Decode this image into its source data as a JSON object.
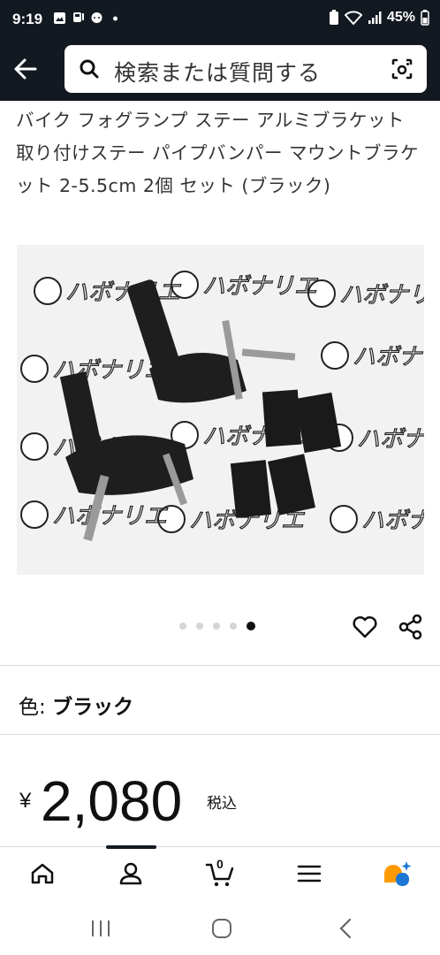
{
  "status_bar": {
    "time": "9:19",
    "battery": "45%"
  },
  "search": {
    "placeholder": "検索または質問する"
  },
  "product": {
    "title": "バイク フォグランプ ステー アルミブラケット 取り付けステー パイプバンパー マウントブラケット 2-5.5cm 2個 セット (ブラック)",
    "image_watermark": "ハボナリエ",
    "carousel": {
      "count": 5,
      "active_index": 4
    },
    "color_label": "色: ",
    "color_value": "ブラック",
    "currency": "¥",
    "price": "2,080",
    "tax_note": "税込"
  },
  "bottom_nav": {
    "items": [
      "home-icon",
      "account-icon",
      "cart-icon",
      "menu-icon",
      "ai-assistant-icon"
    ],
    "active_index": 1,
    "cart_count": "0"
  },
  "colors": {
    "header_bg": "#131921",
    "ai_orange": "#ff9900",
    "ai_blue": "#1c78d4"
  }
}
